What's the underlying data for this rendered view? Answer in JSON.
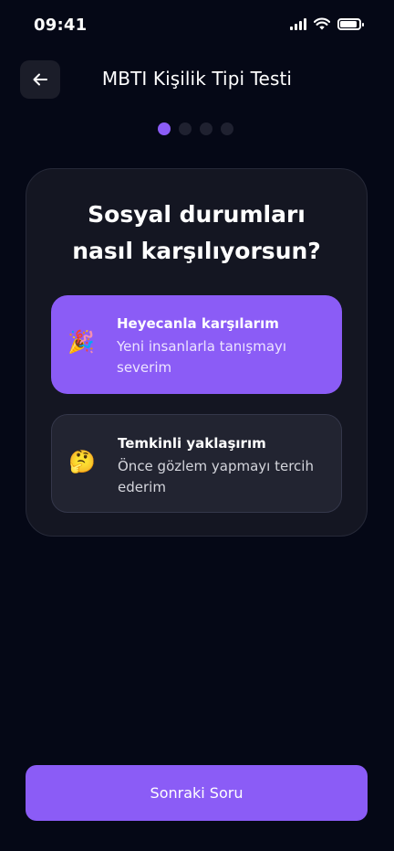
{
  "status_bar": {
    "time": "09:41"
  },
  "header": {
    "title": "MBTI Kişilik Tipi Testi"
  },
  "progress": {
    "current_step": 1,
    "total_steps": 4
  },
  "question": {
    "text": "Sosyal durumları nasıl karşılıyorsun?",
    "options": [
      {
        "icon": "🎉",
        "icon_name": "party-popper-icon",
        "title": "Heyecanla karşılarım",
        "description": "Yeni insanlarla tanışmayı severim",
        "selected": true
      },
      {
        "icon": "🤔",
        "icon_name": "thinking-face-icon",
        "title": "Temkinli yaklaşırım",
        "description": "Önce gözlem yapmayı tercih ederim",
        "selected": false
      }
    ]
  },
  "footer": {
    "next_label": "Sonraki Soru"
  },
  "colors": {
    "background": "#050816",
    "accent": "#8b5cf6",
    "card": "#141622"
  }
}
